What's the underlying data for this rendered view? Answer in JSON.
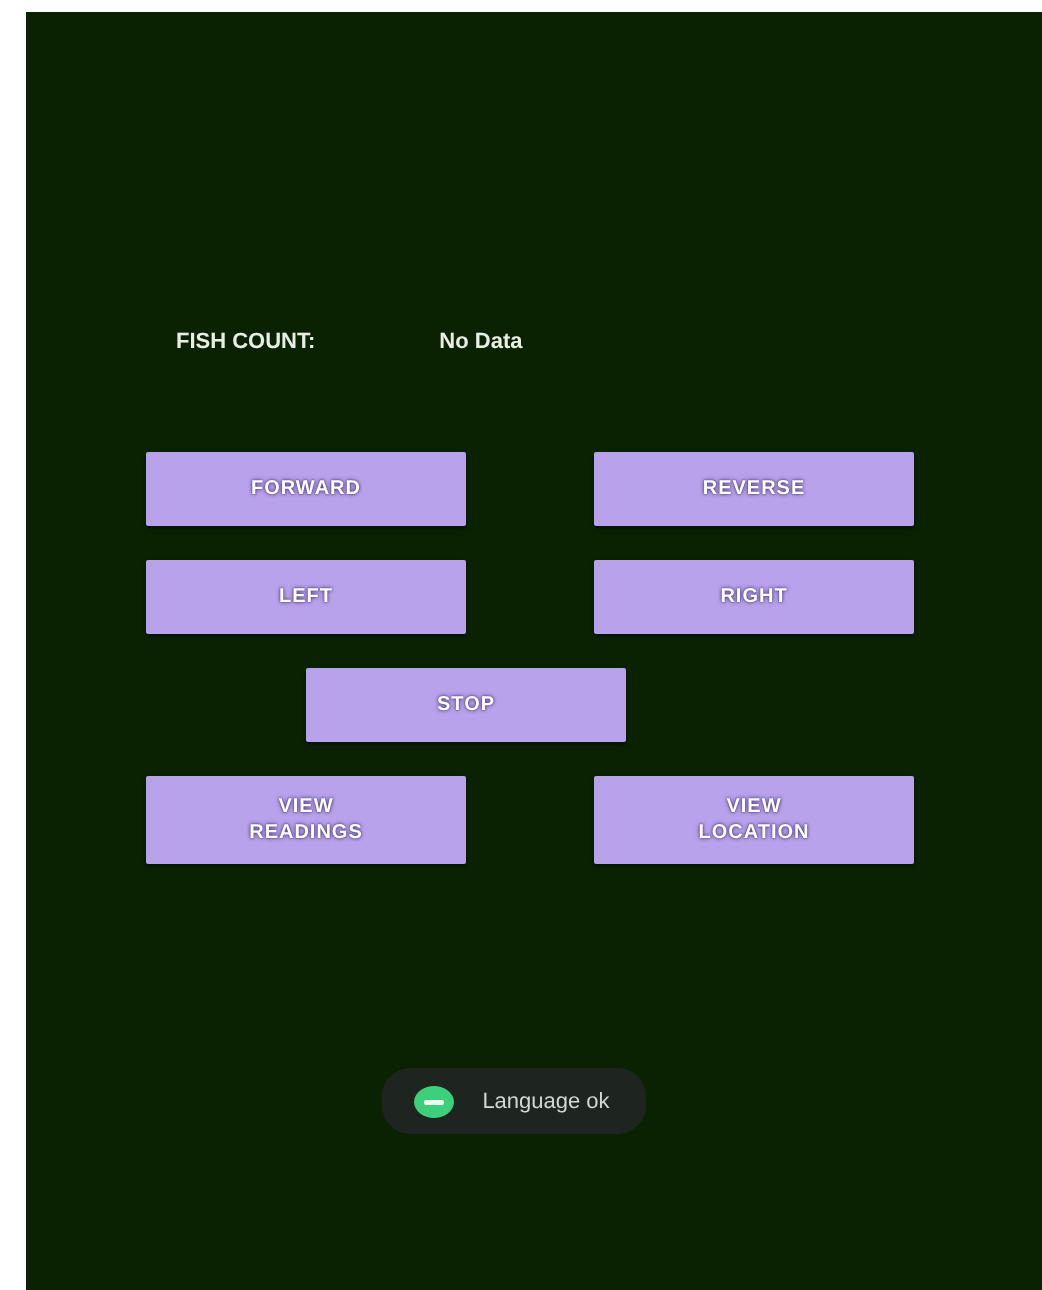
{
  "fish_count": {
    "label": "FISH COUNT:",
    "value": "No Data"
  },
  "buttons": [
    {
      "label": "FORWARD"
    },
    {
      "label": "REVERSE"
    },
    {
      "label": "LEFT"
    },
    {
      "label": "RIGHT"
    },
    {
      "label": "STOP"
    },
    {
      "label": "VIEW READINGS"
    },
    {
      "label": "VIEW LOCATION"
    }
  ],
  "toast": {
    "text": "Language ok"
  }
}
